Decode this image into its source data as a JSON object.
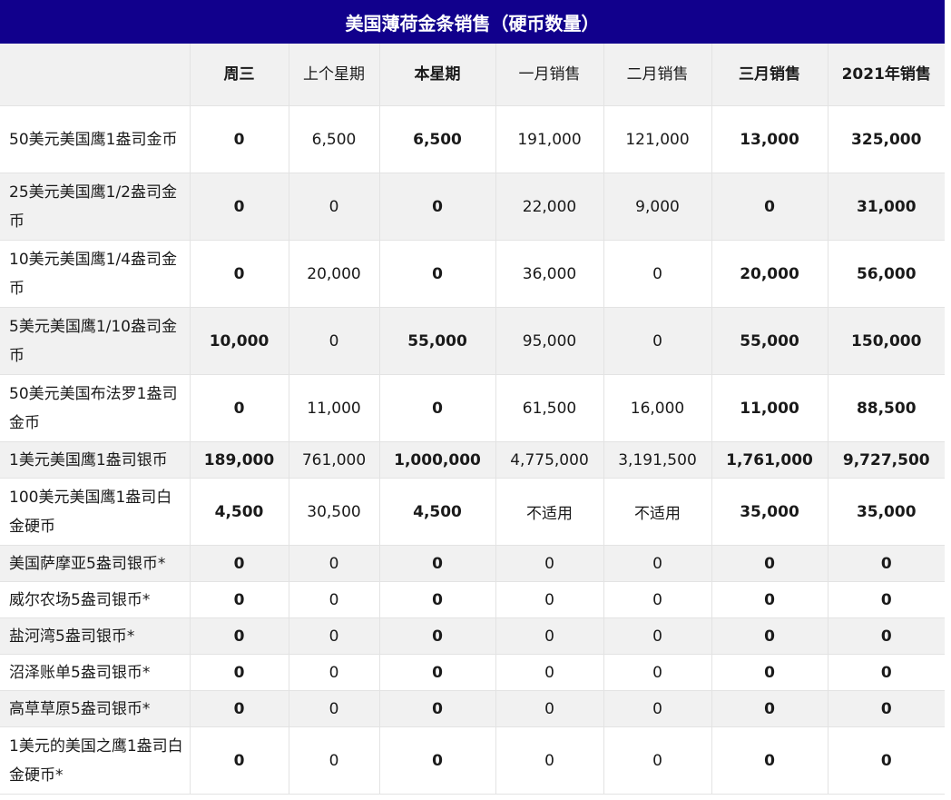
{
  "title": "美国薄荷金条销售（硬币数量）",
  "header": [
    "",
    "周三",
    "上个星期",
    "本星期",
    "一月销售",
    "二月销售",
    "三月销售",
    "2021年销售"
  ],
  "rows": [
    {
      "name": "50美元美国鹰1盎司金币",
      "values": [
        "0",
        "6,500",
        "6,500",
        "191,000",
        "121,000",
        "13,000",
        "325,000"
      ]
    },
    {
      "name": "25美元美国鹰1/2盎司金币",
      "values": [
        "0",
        "0",
        "0",
        "22,000",
        "9,000",
        "0",
        "31,000"
      ]
    },
    {
      "name": "10美元美国鹰1/4盎司金币",
      "values": [
        "0",
        "20,000",
        "0",
        "36,000",
        "0",
        "20,000",
        "56,000"
      ]
    },
    {
      "name": "5美元美国鹰1/10盎司金币",
      "values": [
        "10,000",
        "0",
        "55,000",
        "95,000",
        "0",
        "55,000",
        "150,000"
      ]
    },
    {
      "name": "50美元美国布法罗1盎司金币",
      "values": [
        "0",
        "11,000",
        "0",
        "61,500",
        "16,000",
        "11,000",
        "88,500"
      ]
    },
    {
      "name": "1美元美国鹰1盎司银币",
      "values": [
        "189,000",
        "761,000",
        "1,000,000",
        "4,775,000",
        "3,191,500",
        "1,761,000",
        "9,727,500"
      ]
    },
    {
      "name": "100美元美国鹰1盎司白金硬币",
      "values": [
        "4,500",
        "30,500",
        "4,500",
        "不适用",
        "不适用",
        "35,000",
        "35,000"
      ]
    },
    {
      "name": "美国萨摩亚5盎司银币*",
      "values": [
        "0",
        "0",
        "0",
        "0",
        "0",
        "0",
        "0"
      ]
    },
    {
      "name": "威尔农场5盎司银币*",
      "values": [
        "0",
        "0",
        "0",
        "0",
        "0",
        "0",
        "0"
      ]
    },
    {
      "name": "盐河湾5盎司银币*",
      "values": [
        "0",
        "0",
        "0",
        "0",
        "0",
        "0",
        "0"
      ]
    },
    {
      "name": "沼泽账单5盎司银币*",
      "values": [
        "0",
        "0",
        "0",
        "0",
        "0",
        "0",
        "0"
      ]
    },
    {
      "name": "高草草原5盎司银币*",
      "values": [
        "0",
        "0",
        "0",
        "0",
        "0",
        "0",
        "0"
      ]
    },
    {
      "name": "1美元的美国之鹰1盎司白金硬币*",
      "values": [
        "0",
        "0",
        "0",
        "0",
        "0",
        "0",
        "0"
      ]
    }
  ]
}
